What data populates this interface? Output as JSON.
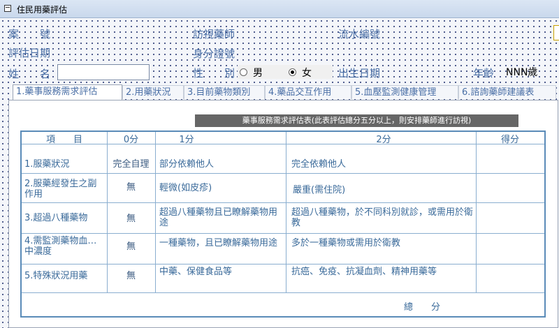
{
  "window": {
    "title": "住民用藥評估"
  },
  "header": {
    "case_no_label": "案　　號",
    "visit_pharmacist_label": "訪視藥師",
    "serial_no_label": "流水編號",
    "assess_date_label": "評估日期",
    "id_no_label": "身分證號",
    "name_label": "姓　　名",
    "gender_label": "性　　別",
    "gender_options": [
      "男",
      "女"
    ],
    "gender_selected": "女",
    "birth_date_label": "出生日期",
    "age_label": "年齡",
    "age_value": "NNN歲",
    "name_value": ""
  },
  "tabs": [
    {
      "label": "1.藥事服務需求評估",
      "active": true
    },
    {
      "label": "2.用藥狀況",
      "active": false
    },
    {
      "label": "3.目前藥物類別",
      "active": false
    },
    {
      "label": "4.藥品交互作用",
      "active": false
    },
    {
      "label": "5.血壓監測健康管理",
      "active": false
    },
    {
      "label": "6.諮詢藥師建議表",
      "active": false
    }
  ],
  "assessment": {
    "banner": "藥事服務需求評估表(此表評估總分五分以上，則安排藥師進行訪視)",
    "columns": [
      "項　　目",
      "0分",
      "1分",
      "2分",
      "得分"
    ],
    "rows": [
      {
        "item": "1.服藥狀況",
        "s0": "完全自理",
        "s1": "部分依賴他人",
        "s2": "完全依賴他人"
      },
      {
        "item": "2.服藥經發生之副作用",
        "s0": "無",
        "s1": "輕微(如皮疹)",
        "s2": "嚴重(需住院)"
      },
      {
        "item": "3.超過八種藥物",
        "s0": "無",
        "s1": "超過八種藥物且已瞭解藥物用途",
        "s2": "超過八種藥物，於不同科別就診，或需用於衛教"
      },
      {
        "item": "4.需監測藥物血…中濃度",
        "s0": "無",
        "s1": "一種藥物，且已瞭解藥物用途",
        "s2": "多於一種藥物或需用於衛教"
      },
      {
        "item": "5.特殊狀況用藥",
        "s0": "無",
        "s1": "中藥、保健食品等",
        "s2": "抗癌、免疫、抗凝血劑、精神用藥等"
      }
    ],
    "total_label": "總　　分"
  }
}
